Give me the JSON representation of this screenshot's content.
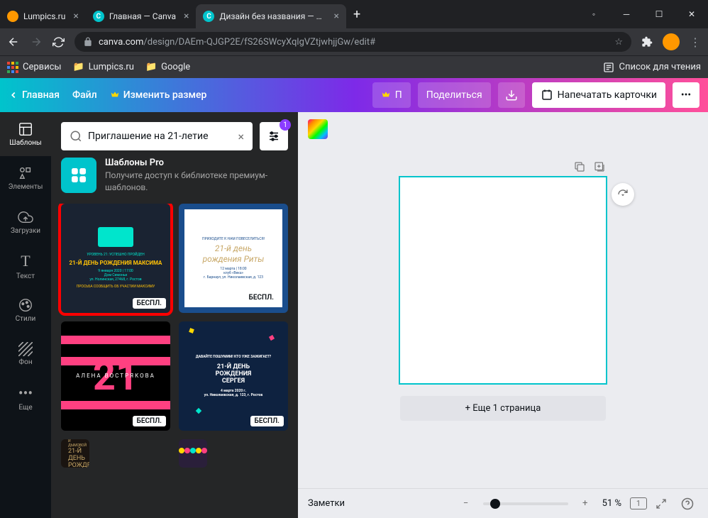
{
  "browser": {
    "tabs": [
      {
        "title": "Lumpics.ru",
        "favicon": "orange"
      },
      {
        "title": "Главная — Canva",
        "favicon": "canva"
      },
      {
        "title": "Дизайн без названия — Пригл",
        "favicon": "canva",
        "active": true
      }
    ],
    "url_prefix": "canva.com",
    "url_rest": "/design/DAEm-QJGP2E/fS26SWcyXqlgVZtjwhjjGw/edit#",
    "bookmarks": {
      "services": "Сервисы",
      "lumpics": "Lumpics.ru",
      "google": "Google",
      "reading_list": "Список для чтения"
    }
  },
  "canva_toolbar": {
    "home": "Главная",
    "file": "Файл",
    "resize": "Изменить размер",
    "p_btn": "П",
    "share": "Поделиться",
    "print": "Напечатать карточки"
  },
  "sidenav": {
    "templates": "Шаблоны",
    "elements": "Элементы",
    "uploads": "Загрузки",
    "text": "Текст",
    "styles": "Стили",
    "background": "Фон",
    "more": "Еще"
  },
  "templates_panel": {
    "search_value": "Приглашение на 21-летие",
    "filter_count": "1",
    "pro_title": "Шаблоны Pro",
    "pro_sub": "Получите доступ к библиотеке премиум-шаблонов.",
    "badge_free": "БЕСПЛ.",
    "tpl1": {
      "level": "УРОВЕНЬ 21: УСПЕШНО ПРОЙДЕН",
      "title": "21-Й ДЕНЬ РОЖДЕНИЯ МАКСИМА",
      "date": "9 января 2020 | 17:00",
      "place": "Дом Симонье",
      "addr": "ул. Нолинская, 27468, г. Ростов",
      "rsvp": "ПРОСЬБА СООБЩИТЬ ОБ УЧАСТИИ МАКСИМУ"
    },
    "tpl2": {
      "top": "ПРИХОДИТЕ К НАМ ПОВЕСЕЛИТЬСЯ!",
      "title1": "21-й день",
      "title2": "рождения Риты",
      "date": "12 марта | 18:00",
      "place": "клуб «Века»",
      "addr": "г. Барнаул, ул. Николаевская, д. 123"
    },
    "tpl3": {
      "num": "21",
      "name": "АЛЕНА ВОСТРЯКОВА"
    },
    "tpl4": {
      "top": "ДАВАЙТЕ ПОШУМИМ! КТО УЖЕ ЗАЖИГАЕТ?",
      "l1": "21-Й ДЕНЬ",
      "l2": "РОЖДЕНИЯ",
      "l3": "СЕРГЕЯ",
      "date": "4 марта 2020 г.",
      "addr": "ул. Николаевская, д. 123, г. Ростов"
    },
    "tpl5": {
      "top": "БАЛЕТ ВОЛГИНОЙ И ДЫМОВОЙ",
      "l1": "21-Й ДЕНЬ",
      "l2": "РОЖДЕНИЯ ФЕЛИ"
    }
  },
  "canvas": {
    "add_page": "+ Еще 1 страница"
  },
  "bottom": {
    "notes": "Заметки",
    "zoom": "51 %",
    "page": "1"
  }
}
